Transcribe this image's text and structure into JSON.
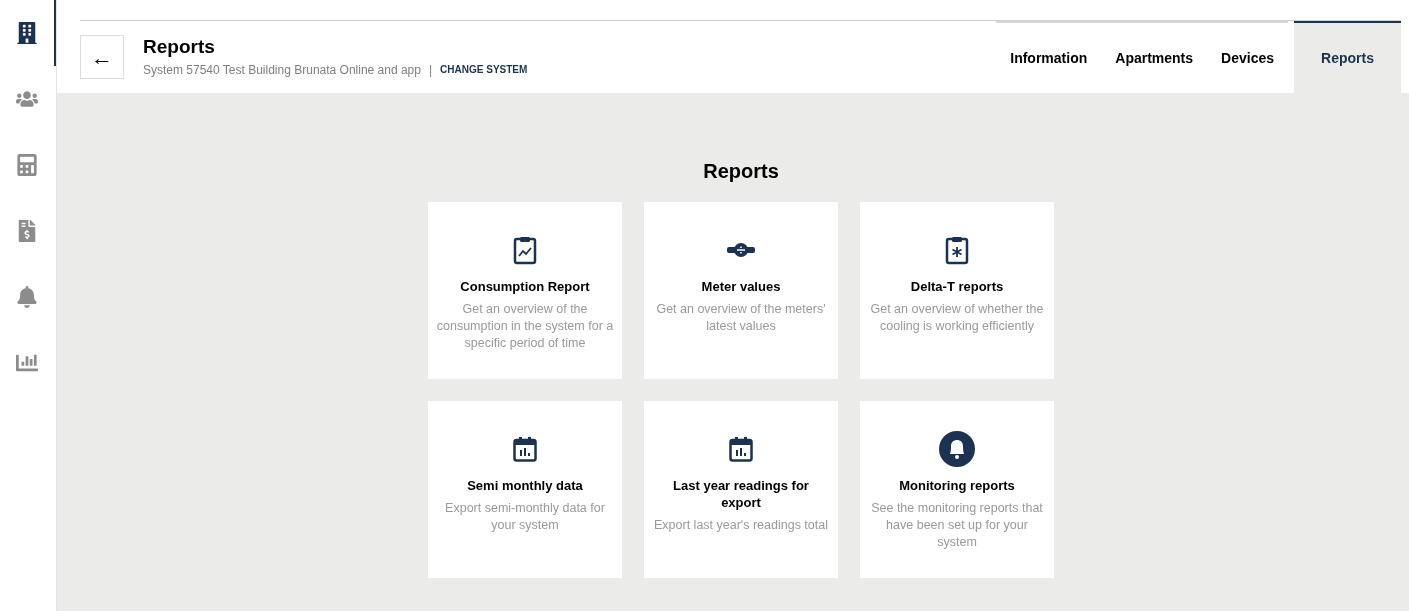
{
  "sidebar": {
    "items": [
      {
        "kind": "building",
        "selected": true
      },
      {
        "kind": "people",
        "selected": false
      },
      {
        "kind": "calculator",
        "selected": false
      },
      {
        "kind": "invoice",
        "selected": false
      },
      {
        "kind": "bell",
        "selected": false
      },
      {
        "kind": "chart",
        "selected": false
      }
    ]
  },
  "header": {
    "back": "←",
    "title": "Reports",
    "subtitle": "System 57540 Test Building Brunata Online and app",
    "separator": "|",
    "action": "CHANGE SYSTEM"
  },
  "tabs": [
    {
      "label": "Information",
      "selected": false
    },
    {
      "label": "Apartments",
      "selected": false
    },
    {
      "label": "Devices",
      "selected": false
    },
    {
      "label": "Reports",
      "selected": true
    }
  ],
  "heading": "Reports",
  "cards": [
    {
      "kind": "clipboard-chart",
      "title": "Consumption Report",
      "description": "Get an overview of the consumption in the system for a specific period of time"
    },
    {
      "kind": "meter",
      "title": "Meter values",
      "description": "Get an overview of the meters' latest values"
    },
    {
      "kind": "clipboard-snow",
      "title": "Delta-T reports",
      "description": "Get an overview of whether the cooling is working efficiently"
    },
    {
      "kind": "calendar",
      "title": "Semi monthly data",
      "description": "Export semi-monthly data for your system"
    },
    {
      "kind": "calendar",
      "title": "Last year readings for export",
      "description": "Export last year's readings total"
    },
    {
      "kind": "bell",
      "title": "Monitoring reports",
      "description": "See the monitoring reports that have been set up for your system"
    }
  ]
}
